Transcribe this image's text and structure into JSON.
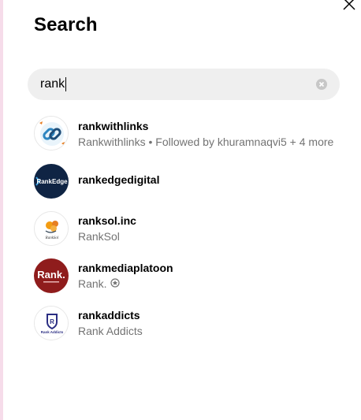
{
  "title": "Search",
  "search": {
    "value": "rank"
  },
  "results": [
    {
      "username": "rankwithlinks",
      "subtitle": "Rankwithlinks • Followed by khuramnaqvi5 + 4 more",
      "avatar_text": "",
      "avatar_bg": "#ffffff"
    },
    {
      "username": "rankedgedigital",
      "subtitle": "",
      "avatar_text": "RankEdge",
      "avatar_bg": "#0f2444"
    },
    {
      "username": "ranksol.inc",
      "subtitle": "RankSol",
      "avatar_text": "RankSol",
      "avatar_bg": "#ffffff"
    },
    {
      "username": "rankmediaplatoon",
      "subtitle": "Rank.",
      "avatar_text": "Rank.",
      "avatar_bg": "#8f1c1c",
      "has_badge": true
    },
    {
      "username": "rankaddicts",
      "subtitle": "Rank Addicts",
      "avatar_text": "Rank Addicts",
      "avatar_bg": "#ffffff"
    }
  ],
  "colors": {
    "secondary_text": "#737373",
    "search_bg": "#efefef",
    "left_strip": "#f6dcea"
  },
  "icons": {
    "close": "close-icon",
    "clear": "clear-search-icon",
    "badge": "badge-icon"
  }
}
